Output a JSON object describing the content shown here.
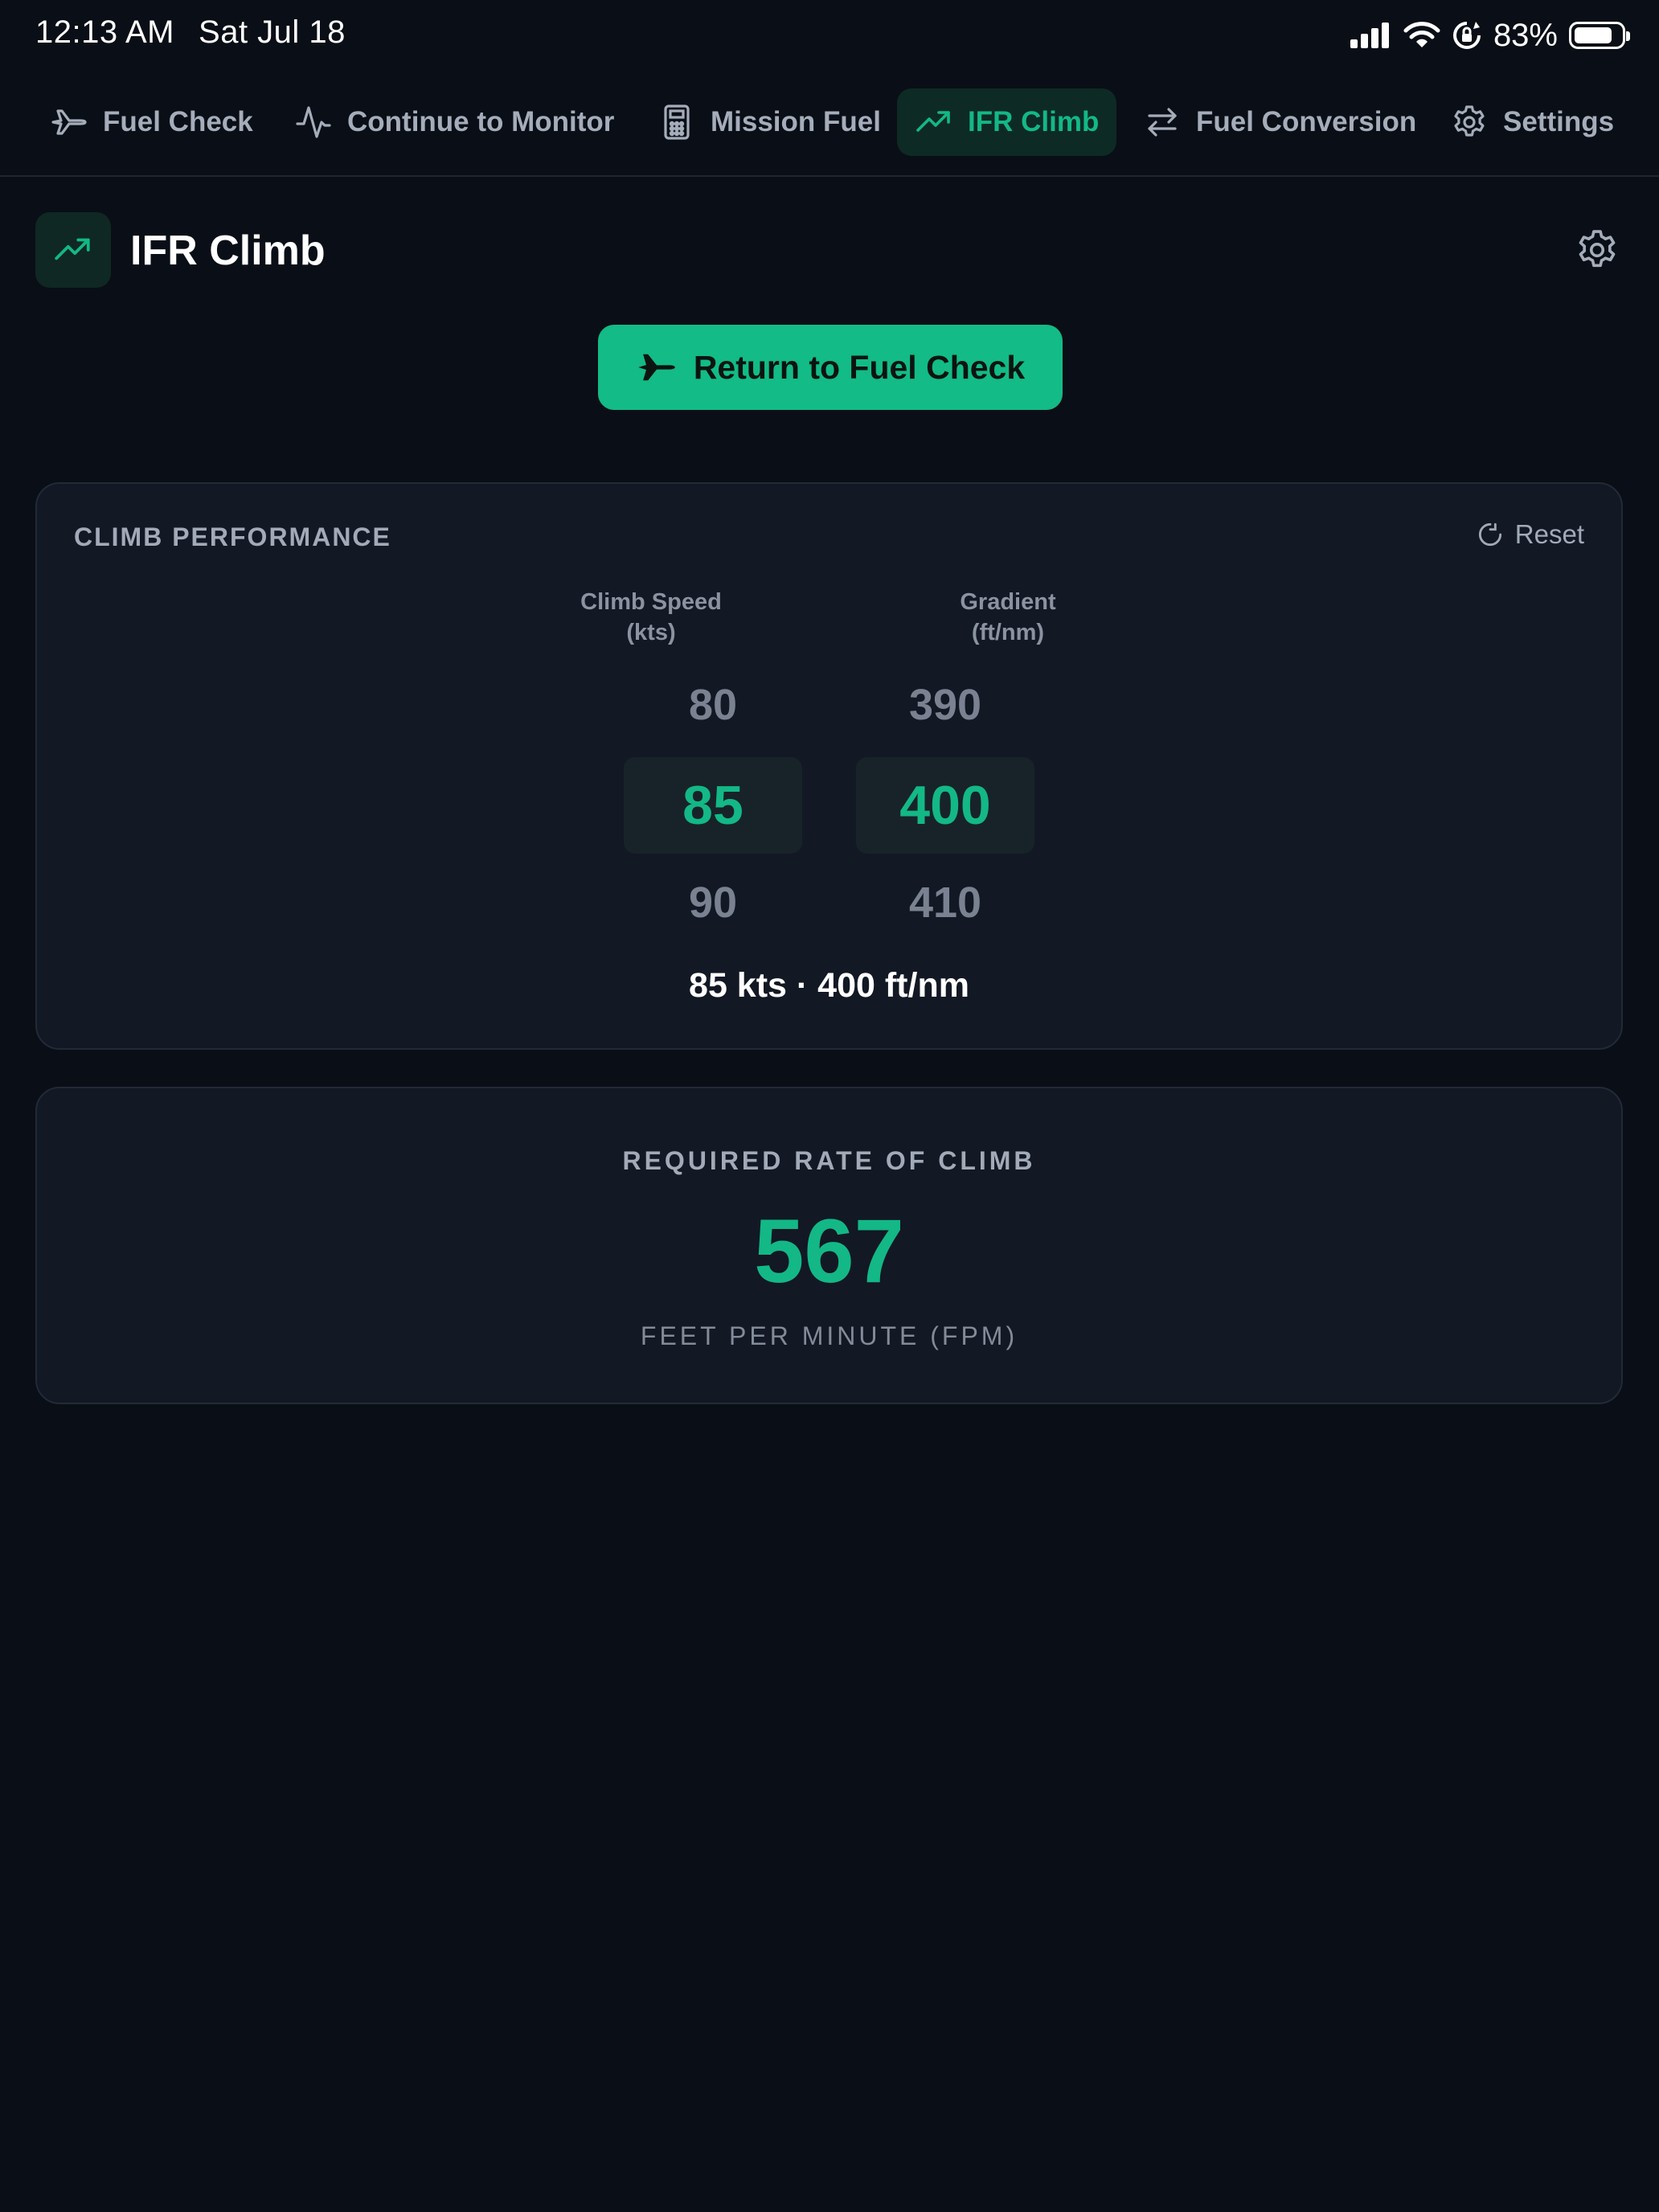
{
  "status_bar": {
    "time": "12:13 AM",
    "date": "Sat Jul 18",
    "battery_percent": "83%",
    "battery_level": 0.83
  },
  "tabs": [
    {
      "label": "Fuel Check",
      "icon": "airplane-icon",
      "active": false
    },
    {
      "label": "Continue to Monitor",
      "icon": "pulse-icon",
      "active": false
    },
    {
      "label": "Mission Fuel",
      "icon": "calculator-icon",
      "active": false
    },
    {
      "label": "IFR Climb",
      "icon": "trending-up-icon",
      "active": true
    },
    {
      "label": "Fuel Conversion",
      "icon": "swap-arrows-icon",
      "active": false
    },
    {
      "label": "Settings",
      "icon": "gear-icon",
      "active": false
    }
  ],
  "header": {
    "title": "IFR Climb",
    "icon": "trending-up-icon"
  },
  "return_button": {
    "label": "Return to Fuel Check",
    "icon": "airplane-icon"
  },
  "climb_card": {
    "title": "CLIMB PERFORMANCE",
    "reset_label": "Reset",
    "speed_column": {
      "label_line1": "Climb Speed",
      "label_line2": "(kts)",
      "prev": "80",
      "selected": "85",
      "next": "90"
    },
    "gradient_column": {
      "label_line1": "Gradient",
      "label_line2": "(ft/nm)",
      "prev": "390",
      "selected": "400",
      "next": "410"
    },
    "summary": "85 kts · 400 ft/nm"
  },
  "roc_card": {
    "label": "REQUIRED RATE OF CLIMB",
    "value": "567",
    "unit": "FEET PER MINUTE (FPM)"
  },
  "colors": {
    "background": "#0a0e16",
    "card": "#121824",
    "accent": "#13b886",
    "button": "#13bb86",
    "muted_text": "#a2aab7"
  }
}
